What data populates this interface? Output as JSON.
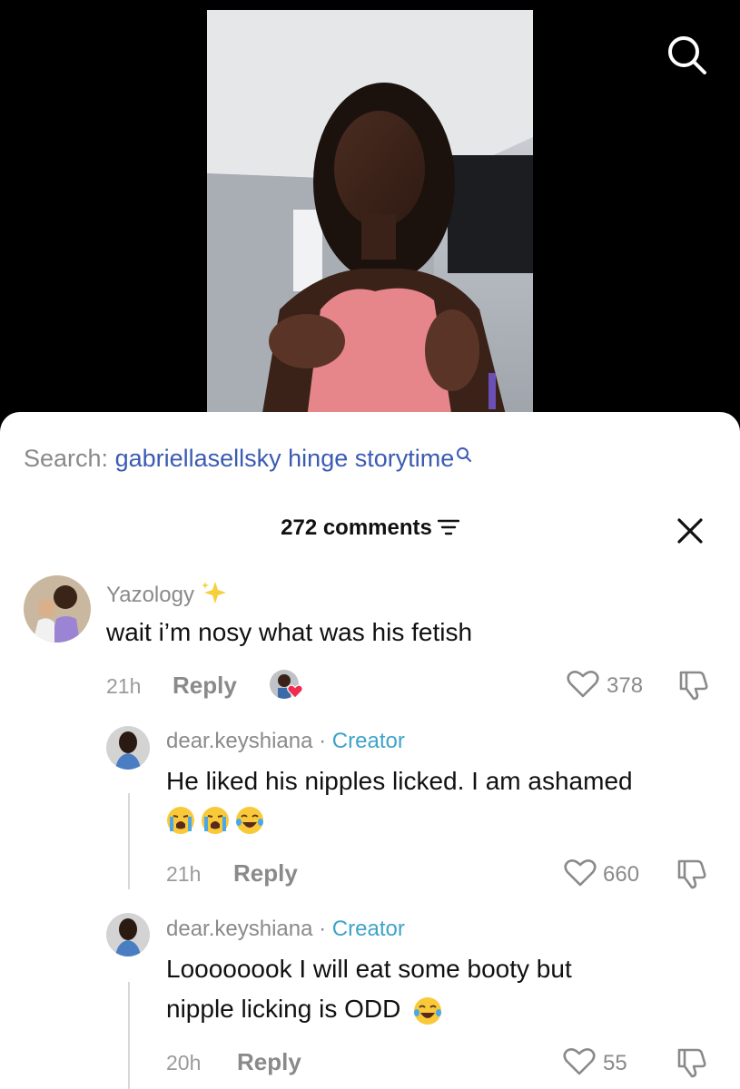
{
  "search": {
    "prefix": "Search:",
    "term": "gabriellasellsky hinge storytime"
  },
  "comments_header": {
    "count_label": "272 comments"
  },
  "comments": [
    {
      "username": "Yazology",
      "text": "wait i’m nosy what was his fetish",
      "time": "21h",
      "reply_label": "Reply",
      "likes": "378"
    }
  ],
  "replies": [
    {
      "username": "dear.keyshiana",
      "separator": "·",
      "tag": "Creator",
      "line1": "He liked his nipples licked. I am ashamed",
      "time": "21h",
      "reply_label": "Reply",
      "likes": "660"
    },
    {
      "username": "dear.keyshiana",
      "separator": "·",
      "tag": "Creator",
      "line1": "Loooooook I will eat some booty but",
      "line2": "nipple licking is ODD",
      "time": "20h",
      "reply_label": "Reply",
      "likes": "55"
    }
  ],
  "colors": {
    "link_blue": "#3b5bb3",
    "creator_blue": "#3fa3c8",
    "muted_gray": "#8a8a8a"
  }
}
